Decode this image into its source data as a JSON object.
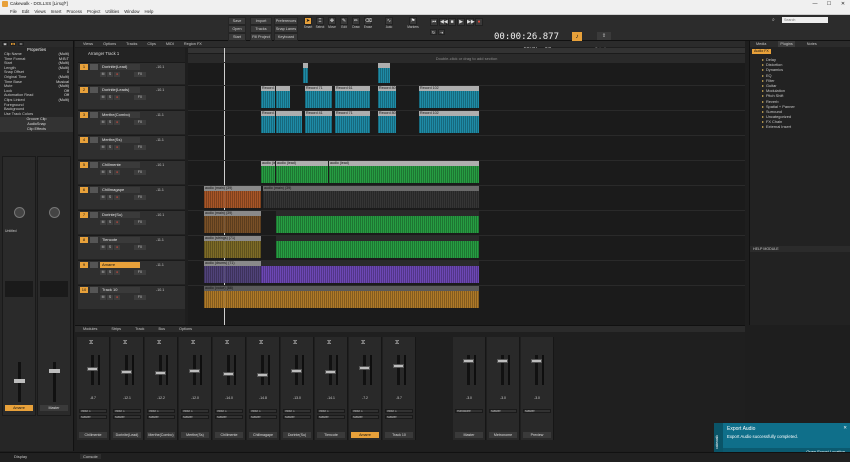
{
  "window": {
    "title": "Cakewalk - DOLLSS [Lirsqf*]",
    "minimize": "—",
    "maximize": "☐",
    "close": "✕"
  },
  "menu": [
    "File",
    "Edit",
    "Views",
    "Insert",
    "Process",
    "Project",
    "Utilities",
    "Window",
    "Help"
  ],
  "toolbar": {
    "file_buttons": [
      "Save",
      "Open",
      "Start Screen"
    ],
    "import_buttons": [
      "Import",
      "Tracks",
      "Fill Project"
    ],
    "pref_buttons": [
      "Preferences",
      "Snap Lanes",
      "Keyboard"
    ],
    "tools": [
      "Smart",
      "Select",
      "Move",
      "Edit",
      "Draw",
      "Erase"
    ],
    "tools_right": [
      "Auto",
      "Markers"
    ],
    "clock": "00:00:26.877",
    "tempo": "200.00",
    "meter": "4/4",
    "search_placeholder": "Search",
    "proj_opt1": "Project",
    "proj_opt2": "Selection"
  },
  "inspector": {
    "title": "Properties",
    "rows": [
      {
        "label": "Clip Name",
        "value": "(Multi)"
      },
      {
        "label": "Time Format",
        "value": "M:B:T"
      },
      {
        "label": "Start",
        "value": "(Multi)"
      },
      {
        "label": "Length",
        "value": "(Multi)"
      },
      {
        "label": "Snap Offset",
        "value": "0"
      },
      {
        "label": "Original Time",
        "value": "(Multi)"
      },
      {
        "label": "Time Base",
        "value": "Musical"
      },
      {
        "label": "Mute",
        "value": "(Multi)"
      },
      {
        "label": "Lock",
        "value": "Off"
      },
      {
        "label": "Automation Read",
        "value": "Off"
      },
      {
        "label": "Clips Linked",
        "value": "(Multi)"
      },
      {
        "label": "Foreground",
        "value": ""
      },
      {
        "label": "Background",
        "value": ""
      },
      {
        "label": "Use Track Colors",
        "value": ""
      }
    ],
    "sections": [
      "Groove Clip",
      "AudioSnap",
      "Clip Effects"
    ],
    "strip_a_name": "Amarre",
    "strip_b_name": "Master",
    "strip_a_db": "-8.1",
    "strip_b_db": "-0.0",
    "input_label": "Untitled",
    "panel_tabs": [
      "Clip",
      "Track"
    ]
  },
  "tracks_view": {
    "tabs": [
      "Views",
      "Options",
      "Tracks",
      "Clips",
      "MIDI",
      "Region FX"
    ],
    "arranger": "Arranger Track 1",
    "lane_hint": "Double-click or drag to add section",
    "tracks": [
      {
        "num": "1",
        "name": "Dorinite(Lead)",
        "vol": "-10.1"
      },
      {
        "num": "2",
        "name": "Dorinite(Leads)",
        "vol": "-10.1"
      },
      {
        "num": "3",
        "name": "Merthe(Combo)",
        "vol": "-11.1"
      },
      {
        "num": "4",
        "name": "Merthe(Ss)",
        "vol": "-11.1"
      },
      {
        "num": "5",
        "name": "Chillmente",
        "vol": "-10.1"
      },
      {
        "num": "6",
        "name": "Chillmagape",
        "vol": "-11.1"
      },
      {
        "num": "7",
        "name": "Dorinte(Su)",
        "vol": "-10.1"
      },
      {
        "num": "8",
        "name": "Tiencote",
        "vol": "-11.1"
      },
      {
        "num": "9",
        "name": "Amarre",
        "vol": "-11.1"
      },
      {
        "num": "10",
        "name": "Track 10",
        "vol": "-10.1"
      }
    ],
    "clips": {
      "record21": "Record 21",
      "record41": "Record 41",
      "record71": "Record 71",
      "record80": "Record 80",
      "record102": "Record 102",
      "record61": "Record 61",
      "record31": "Record 31",
      "audio": "audio (lead)",
      "audio_main": "audio (main) (39)",
      "audio_s": "audio (strings) (71)",
      "audio_vox": "audio (voice) (88)",
      "audio_d": "audio (drums) (71)"
    }
  },
  "browser": {
    "tabs": [
      "Media",
      "Plugins",
      "Notes"
    ],
    "filter": "Audio FX",
    "items": [
      "Delay",
      "Distortion",
      "Dynamics",
      "EQ",
      "Filter",
      "Guitar",
      "Modulation",
      "Pitch Shift",
      "Reverb",
      "Spatial + Panner",
      "Surround",
      "Uncategorized",
      "FX Chain",
      "External Insert"
    ],
    "help_title": "HELP MODULE"
  },
  "console": {
    "tabs": [
      "Modules",
      "Strips",
      "Track",
      "Bus",
      "Options"
    ],
    "strips": [
      {
        "name": "Chillmente",
        "db": "-8.7",
        "out": "Master",
        "in": "Input 1"
      },
      {
        "name": "Dorinite(Lead)",
        "db": "-12.1",
        "out": "Master",
        "in": "Input 1"
      },
      {
        "name": "Merthe(Combo)",
        "db": "-12.2",
        "out": "Master",
        "in": "Input 1"
      },
      {
        "name": "Merthe(Ss)",
        "db": "-12.0",
        "out": "Master",
        "in": "Input 1"
      },
      {
        "name": "Chillmente",
        "db": "-14.0",
        "out": "Master",
        "in": "Input 1"
      },
      {
        "name": "Chillmagape",
        "db": "-14.8",
        "out": "Master",
        "in": "Input 1"
      },
      {
        "name": "Dorinte(Su)",
        "db": "-13.0",
        "out": "Master",
        "in": "Input 1"
      },
      {
        "name": "Tiencote",
        "db": "-14.1",
        "out": "Master",
        "in": "Input 1"
      },
      {
        "name": "Amarre",
        "db": "-7.2",
        "out": "Master",
        "in": "Input 1"
      },
      {
        "name": "Track 10",
        "db": "-5.7",
        "out": "Master",
        "in": "Input 1"
      }
    ],
    "bus_strips": [
      {
        "name": "Master",
        "db": "-3.0",
        "out": "Hardware"
      },
      {
        "name": "Metronome",
        "db": "-3.0",
        "out": "Master"
      },
      {
        "name": "Preview",
        "db": "-3.0",
        "out": "Master"
      }
    ]
  },
  "toast": {
    "title": "Export Audio",
    "message": "Export Audio successfully completed.",
    "action": "Open Export Location",
    "brand": "cakewalk"
  },
  "statusbar": {
    "tab1": "Console",
    "tab2": "Display"
  }
}
